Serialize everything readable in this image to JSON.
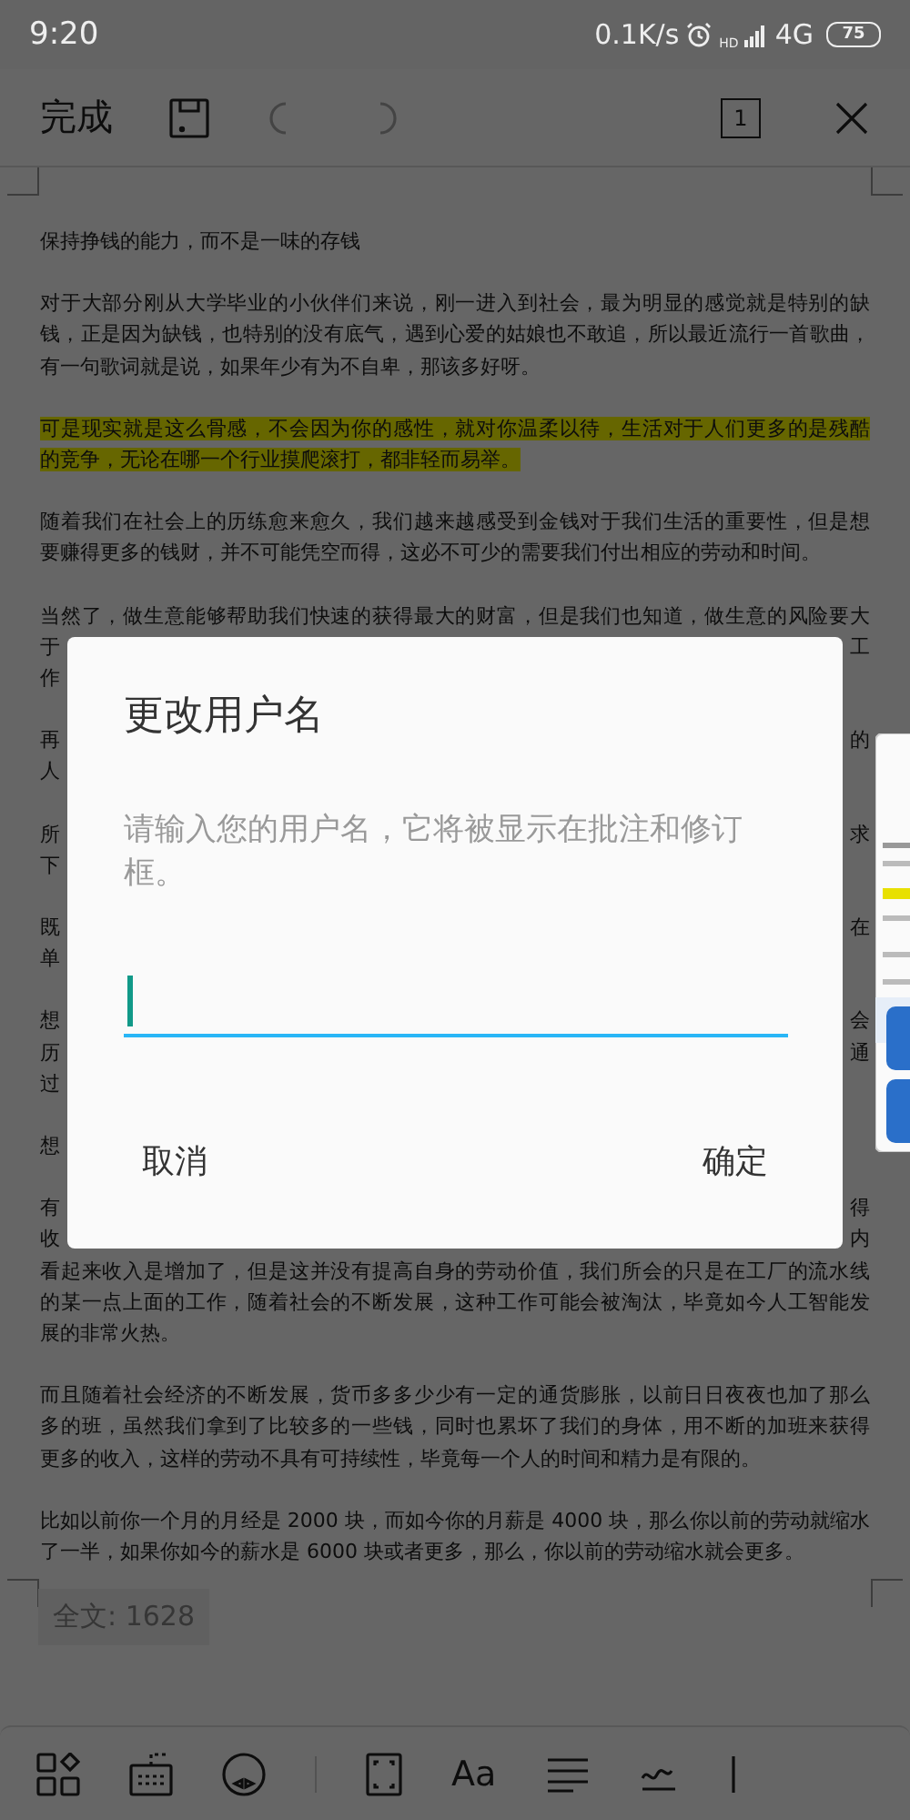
{
  "status_bar": {
    "time": "9:20",
    "speed": "0.1K/s",
    "hd": "HD",
    "network": "4G",
    "battery": "75"
  },
  "toolbar": {
    "done": "完成",
    "undo_disabled": true,
    "redo_disabled": true,
    "page_number": "1"
  },
  "document": {
    "paragraphs": [
      {
        "lines": [
          {
            "kind": "full",
            "text": "保持挣钱的能力，而不是一味的存钱"
          }
        ]
      },
      {
        "lines": [
          {
            "kind": "full",
            "text": "对于大部分刚从大学毕业的小伙伴们来说，刚一进入到社会，最为明显的感觉就是特别的缺"
          },
          {
            "kind": "full",
            "text": "钱，正是因为缺钱，也特别的没有底气，遇到心爱的姑娘也不敢追，所以最近流行一首歌曲，"
          },
          {
            "kind": "full",
            "text": "有一句歌词就是说，如果年少有为不自卑，那该多好呀。"
          }
        ]
      },
      {
        "lines": [
          {
            "kind": "highlighted",
            "text": "可是现实就是这么骨感，不会因为你的感性，就对你温柔以待，生活对于人们更多的是残酷"
          },
          {
            "kind": "highlighted",
            "text": "的竞争，无论在哪一个行业摸爬滚打，都非轻而易举。"
          }
        ]
      },
      {
        "lines": [
          {
            "kind": "full",
            "text": "随着我们在社会上的历练愈来愈久，我们越来越感受到金钱对于我们生活的重要性，但是想"
          },
          {
            "kind": "full",
            "text": "要赚得更多的钱财，并不可能凭空而得，这必不可少的需要我们付出相应的劳动和时间。"
          }
        ]
      },
      {
        "lines": [
          {
            "kind": "full",
            "text": "当然了，做生意能够帮助我们快速的获得最大的财富，但是我们也知道，做生意的风险要大"
          },
          {
            "kind": "split",
            "left": "于",
            "right": "工"
          },
          {
            "kind": "split",
            "left": "作"
          }
        ]
      },
      {
        "lines": [
          {
            "kind": "split",
            "left": "再",
            "right": "的"
          },
          {
            "kind": "split",
            "left": "人"
          }
        ]
      },
      {
        "lines": [
          {
            "kind": "split",
            "left": "所",
            "right": "求"
          },
          {
            "kind": "split",
            "left": "下"
          }
        ]
      },
      {
        "lines": [
          {
            "kind": "split",
            "left": "既",
            "right": "在"
          },
          {
            "kind": "split",
            "left": "单"
          }
        ]
      },
      {
        "lines": [
          {
            "kind": "split",
            "left": "想",
            "right": "会"
          },
          {
            "kind": "split",
            "left": "历",
            "right": "通"
          },
          {
            "kind": "split",
            "left": "过"
          }
        ]
      },
      {
        "lines": [
          {
            "kind": "split",
            "left": "想"
          }
        ]
      },
      {
        "lines": [
          {
            "kind": "split",
            "left": "有",
            "right": "得"
          },
          {
            "kind": "split",
            "left": "收",
            "right": "内"
          },
          {
            "kind": "full",
            "text": "看起来收入是增加了，但是这并没有提高自身的劳动价值，我们所会的只是在工厂的流水线"
          },
          {
            "kind": "full",
            "text": "的某一点上面的工作，随着社会的不断发展，这种工作可能会被淘汰，毕竟如今人工智能发"
          },
          {
            "kind": "full",
            "text": "展的非常火热。"
          }
        ]
      },
      {
        "lines": [
          {
            "kind": "full",
            "text": "而且随着社会经济的不断发展，货币多多少少有一定的通货膨胀，以前日日夜夜也加了那么"
          },
          {
            "kind": "full",
            "text": "多的班，虽然我们拿到了比较多的一些钱，同时也累坏了我们的身体，用不断的加班来获得"
          },
          {
            "kind": "full",
            "text": "更多的收入，这样的劳动不具有可持续性，毕竟每一个人的时间和精力是有限的。"
          }
        ]
      },
      {
        "lines": [
          {
            "kind": "full",
            "text": "比如以前你一个月的月经是 2000 块，而如今你的月薪是 4000 块，那么你以前的劳动就缩水"
          },
          {
            "kind": "full",
            "text": "了一半，如果你如今的薪水是 6000 块或者更多，那么，你以前的劳动缩水就会更多。"
          }
        ]
      }
    ]
  },
  "word_count": "全文: 1628",
  "bottom_toolbar": {
    "font_label": "Aa"
  },
  "dialog": {
    "title": "更改用户名",
    "message": "请输入您的用户名，它将被显示在批注和修订框。",
    "buttons": [
      "取消",
      "确定"
    ]
  }
}
